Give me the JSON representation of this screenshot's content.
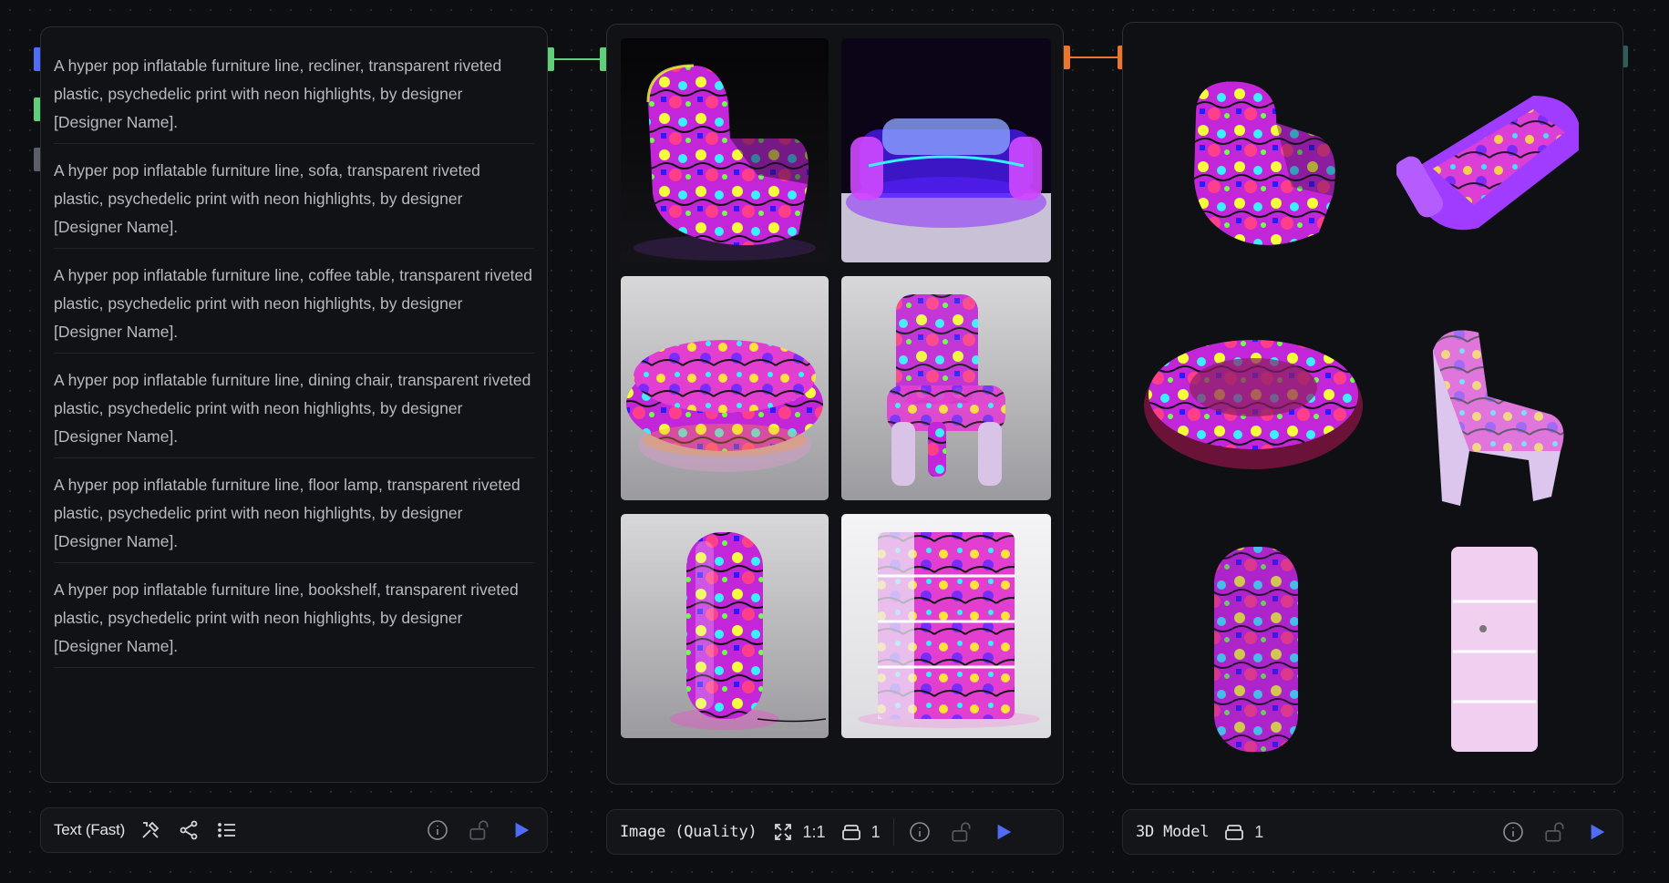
{
  "text_node": {
    "prompts": [
      "A hyper pop inflatable furniture line, recliner, transparent riveted plastic, psychedelic print with neon highlights, by designer [Designer Name].",
      "A hyper pop inflatable furniture line, sofa, transparent riveted plastic, psychedelic print with neon highlights, by designer [Designer Name].",
      "A hyper pop inflatable furniture line, coffee table, transparent riveted plastic, psychedelic print with neon highlights, by designer [Designer Name].",
      "A hyper pop inflatable furniture line, dining chair, transparent riveted plastic, psychedelic print with neon highlights, by designer [Designer Name].",
      "A hyper pop inflatable furniture line, floor lamp, transparent riveted plastic, psychedelic print with neon highlights, by designer [Designer Name].",
      "A hyper pop inflatable furniture line, bookshelf, transparent riveted plastic, psychedelic print with neon highlights, by designer [Designer Name]."
    ],
    "toolbar": {
      "title": "Text (Fast)"
    }
  },
  "image_node": {
    "toolbar": {
      "title": "Image (Quality)",
      "aspect": "1:1",
      "count": "1"
    },
    "images": [
      {
        "subject": "recliner"
      },
      {
        "subject": "sofa"
      },
      {
        "subject": "coffee table"
      },
      {
        "subject": "dining chair"
      },
      {
        "subject": "floor lamp"
      },
      {
        "subject": "bookshelf"
      }
    ]
  },
  "model_node": {
    "toolbar": {
      "title": "3D Model",
      "count": "1"
    }
  },
  "colors": {
    "accent_play": "#4f6cf7",
    "port_blue": "#4f6cf7",
    "port_green": "#5fcf7a",
    "port_gray": "#5a5e66",
    "port_orange": "#e8762e",
    "port_teal": "#2f5e5a",
    "neon_pink": "#ff3fd6",
    "neon_purple": "#8a2cff",
    "neon_yellow": "#f5ff3a",
    "neon_cyan": "#3af0ff"
  },
  "icons": [
    "tools-icon",
    "share-icon",
    "list-icon",
    "info-icon",
    "unlock-icon",
    "play-icon",
    "expand-icon",
    "layers-icon"
  ]
}
